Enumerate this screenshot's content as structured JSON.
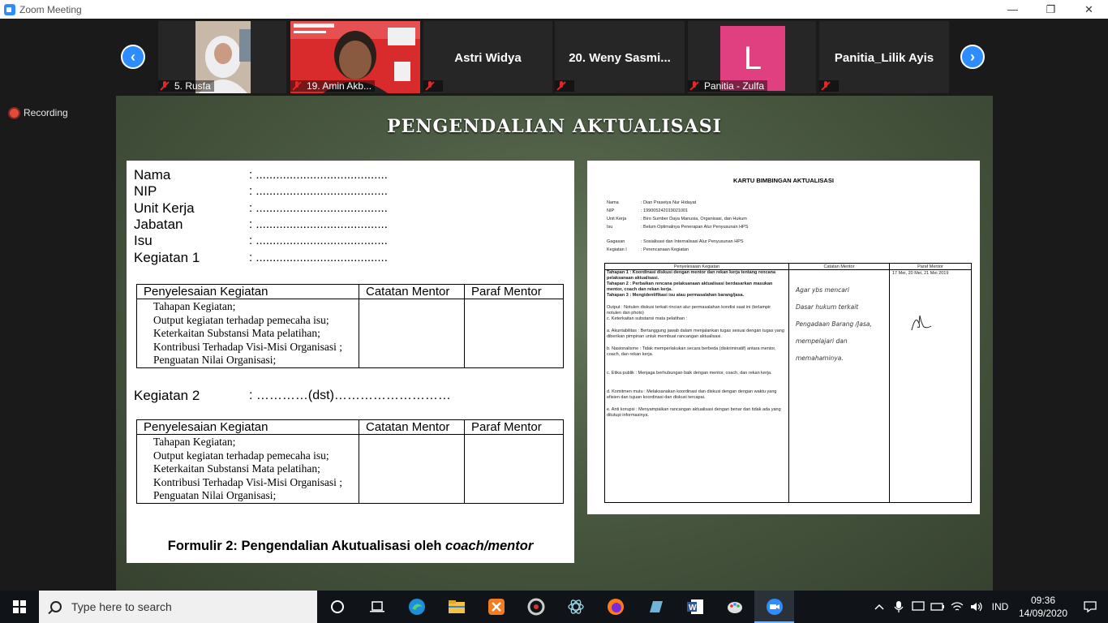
{
  "window": {
    "title": "Zoom Meeting",
    "minimize": "—",
    "maximize": "❐",
    "close": "✕"
  },
  "participants": [
    {
      "name": "5. Rusfa",
      "type": "video",
      "muted": true
    },
    {
      "name": "19. Amin Akb...",
      "type": "video",
      "muted": true
    },
    {
      "name": "Astri Widya",
      "type": "name",
      "muted": true
    },
    {
      "name": "20. Weny Sasmi...",
      "type": "name",
      "muted": true
    },
    {
      "name": "Panitia - Zulfa",
      "type": "avatar",
      "initial": "L",
      "avatar_color": "#e0407f",
      "muted": true
    },
    {
      "name": "Panitia_Lilik Ayis",
      "type": "name",
      "muted": true
    }
  ],
  "nav": {
    "prev": "‹",
    "next": "›"
  },
  "recording": {
    "label": "Recording"
  },
  "slide": {
    "title": "PENGENDALIAN AKTUALISASI",
    "form": {
      "fields": [
        "Nama",
        "NIP",
        "Unit Kerja",
        "Jabatan",
        "Isu",
        "Kegiatan 1"
      ],
      "dots": ": .......................................",
      "table_headers": [
        "Penyelesaian Kegiatan",
        "Catatan Mentor",
        "Paraf Mentor"
      ],
      "table_items": [
        "Tahapan Kegiatan;",
        "Output kegiatan terhadap pemecaha isu;",
        "Keterkaitan Substansi Mata pelatihan;",
        "Kontribusi Terhadap Visi-Misi Organisasi ;",
        "Penguatan Nilai Organisasi;"
      ],
      "kegiatan2_label": "Kegiatan 2",
      "kegiatan2_dots": ": …………(dst)………………………",
      "caption": "Formulir 2: Pengendalian Akutualisasi oleh ",
      "caption_italic": "coach/mentor"
    },
    "kartu": {
      "title": "KARTU BIMBINGAN AKTUALISASI",
      "info": [
        {
          "k": "Nama",
          "v": ": Dian Prasetya Nur Hidayat"
        },
        {
          "k": "NIP",
          "v": ": 199005242019021001"
        },
        {
          "k": "Unit Kerja",
          "v": ": Biro Sumber Daya Manusia, Organisasi, dan Hukum"
        },
        {
          "k": "Isu",
          "v": ": Belum Optimalnya Penerapan Alur Penyusunan HPS"
        }
      ],
      "info2": [
        {
          "k": "Gagasan",
          "v": ": Sosialisasi dan Internalisasi Alur Penyusunan HPS"
        },
        {
          "k": "Kegiatan I",
          "v": ": Perencanaan Kegiatan"
        }
      ],
      "headers": [
        "Penyelesaian Kegiatan",
        "Catatan Mentor",
        "Paraf Mentor"
      ],
      "body": [
        "Tahapan 1 : Koordinasi diskusi dengan mentor dan rekan kerja tentang rencana pelaksanaan aktualisasi.",
        "Tahapan 2 : Perbaikan rencana pelaksanaan aktualisasi berdasarkan masukan mentor, coach dan rekan kerja.",
        "Tahapan 3 : Mengidentifikasi isu atau permasalahan barang/jasa.",
        "",
        "Output : Notulen diskusi terkait rincian alur permasalahan kondisi saat ini (terlampir notulen dan photo)",
        "c. Keterkaitan substansi mata pelatihan :",
        "",
        "a.  Akuntabilitas : Bertanggung jawab dalam menjalankan tugas sesuai dengan tugas yang diberikan pimpinan untuk membuat rancangan aktualisasi.",
        "",
        "b.  Nasionalisme : Tidak memperlakukan secara berbeda (diskriminatif) antara mentor, coach, dan rekan kerja.",
        "",
        "",
        "c.  Etika publik : Menjaga berhubungan baik dengan mentor, coach, dan rekan kerja.",
        "",
        "",
        "d.  Komitmen mutu : Melaksanakan koordinasi dan diskusi dengan dengan waktu yang efisien dan tujuan koordinasi dan diskusi tercapai.",
        "",
        "e.  Anti korupsi : Menyampaikan rancangan aktualisasi dengan benar dan tidak ada yang ditutupi informasinya."
      ],
      "handwriting": [
        "Agar ybs mencari",
        "Dasar hukum terkait",
        "Pengadaan Barang /Jasa,",
        "mempelajari dan",
        "memahaminya."
      ],
      "dates": "17 Mei, 20 Mei, 21 Mei 2019"
    }
  },
  "taskbar": {
    "search_placeholder": "Type here to search",
    "apps": [
      "cortana-icon",
      "task-view-icon",
      "edge-icon",
      "file-explorer-icon",
      "xampp-icon",
      "media-icon",
      "electron-icon",
      "firefox-icon",
      "app-icon",
      "word-icon",
      "paint-icon",
      "zoom-icon"
    ],
    "language": "IND",
    "time": "09:36",
    "date": "14/09/2020"
  }
}
